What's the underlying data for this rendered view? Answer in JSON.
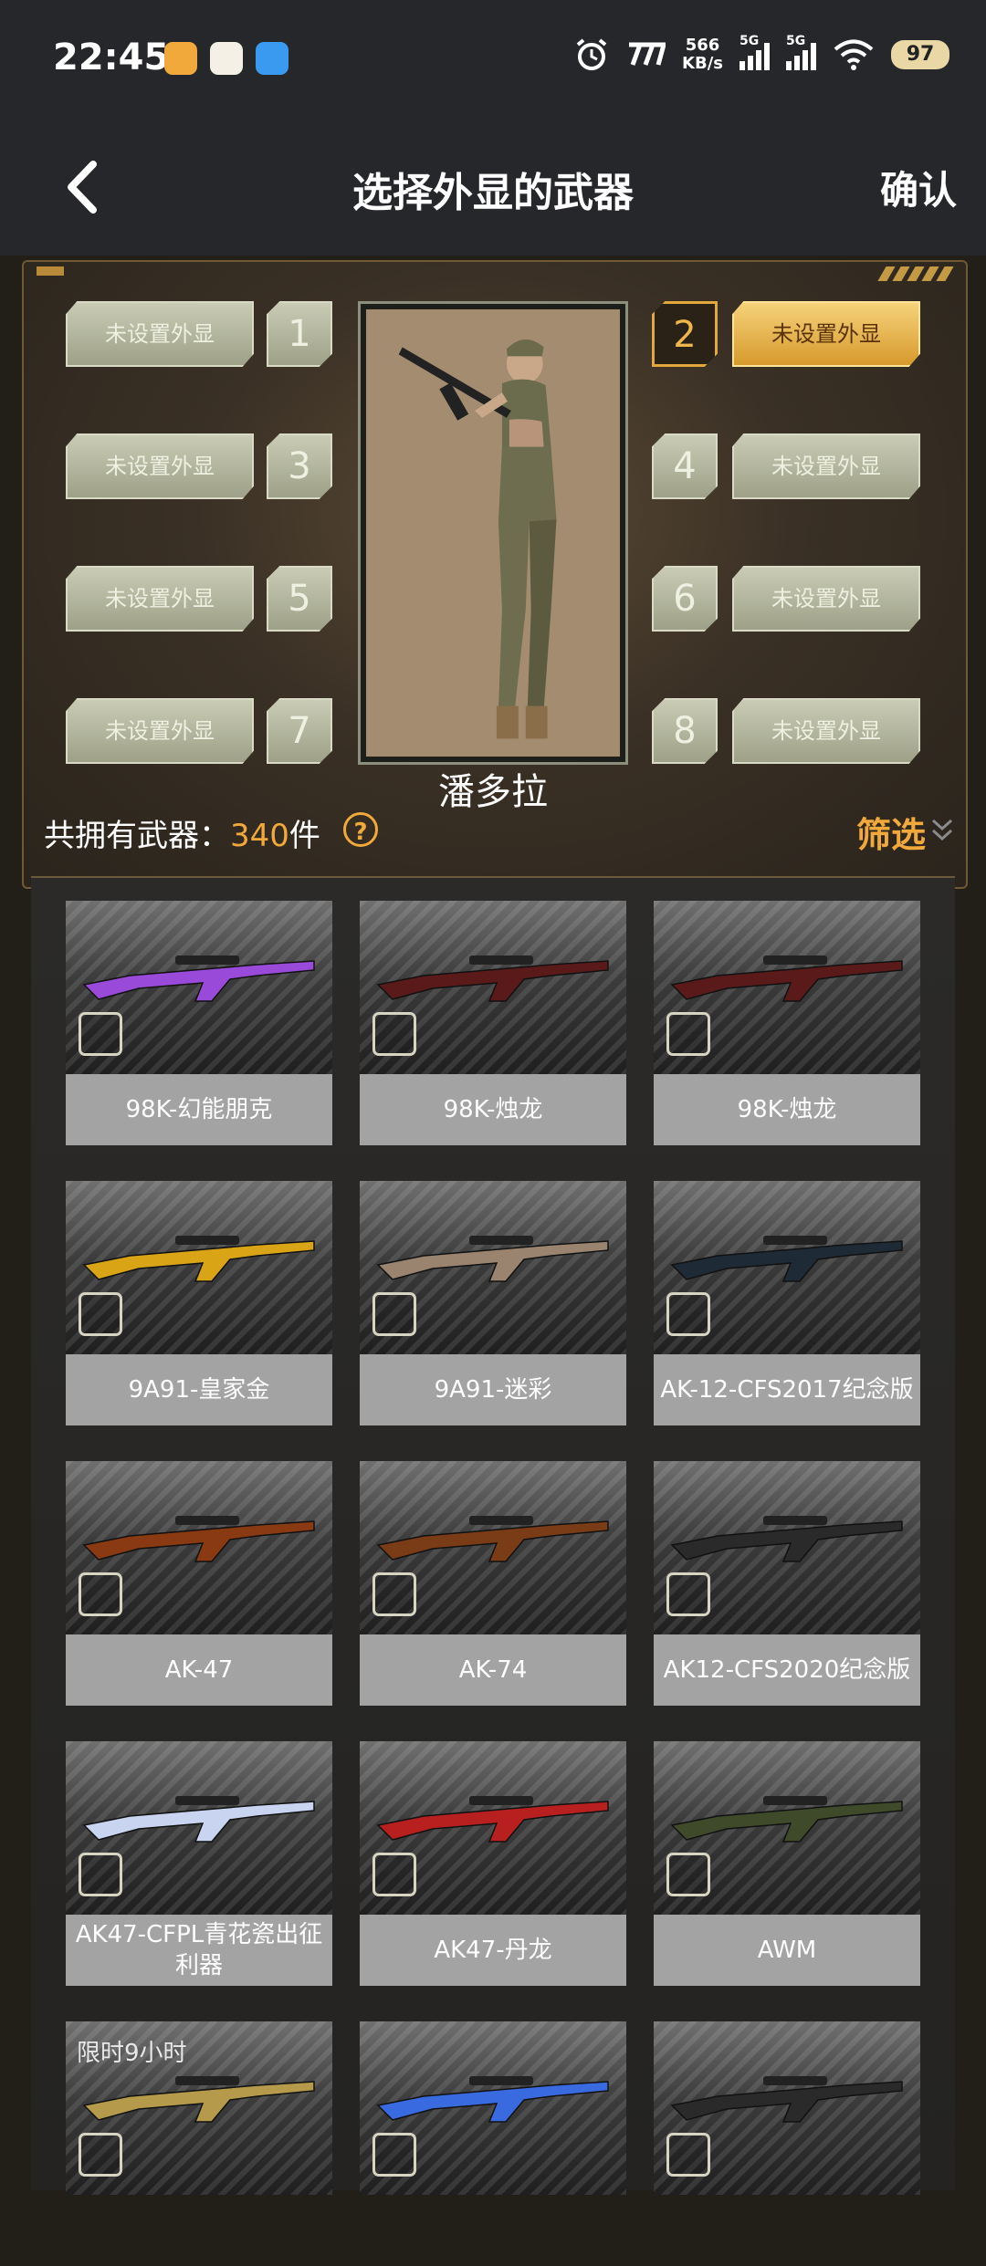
{
  "status": {
    "time": "22:45",
    "net_speed_value": "566",
    "net_speed_unit": "KB/s",
    "sig1_tag": "5G",
    "sig2_tag": "5G",
    "battery": "97"
  },
  "header": {
    "title": "选择外显的武器",
    "confirm": "确认"
  },
  "slots": [
    {
      "label": "未设置外显",
      "num": "1"
    },
    {
      "label": "未设置外显",
      "num": "2",
      "active": true
    },
    {
      "label": "未设置外显",
      "num": "3"
    },
    {
      "label": "未设置外显",
      "num": "4"
    },
    {
      "label": "未设置外显",
      "num": "5"
    },
    {
      "label": "未设置外显",
      "num": "6"
    },
    {
      "label": "未设置外显",
      "num": "7"
    },
    {
      "label": "未设置外显",
      "num": "8"
    }
  ],
  "character": {
    "name": "潘多拉"
  },
  "summary": {
    "prefix": "共拥有武器：",
    "count": "340",
    "suffix": "件",
    "help": "?",
    "filter": "筛选"
  },
  "weapons": [
    {
      "name": "98K-幻能朋克",
      "color": "#9a4ad8"
    },
    {
      "name": "98K-烛龙",
      "color": "#5a1a1a"
    },
    {
      "name": "98K-烛龙",
      "color": "#5a1a1a"
    },
    {
      "name": "9A91-皇家金",
      "color": "#d9a516"
    },
    {
      "name": "9A91-迷彩",
      "color": "#9a8470"
    },
    {
      "name": "AK-12-CFS2017纪念版",
      "color": "#1e2a36"
    },
    {
      "name": "AK-47",
      "color": "#8a3a12"
    },
    {
      "name": "AK-74",
      "color": "#7a3c16"
    },
    {
      "name": "AK12-CFS2020纪念版",
      "color": "#2a2a2a"
    },
    {
      "name": "AK47-CFPL青花瓷出征利器",
      "color": "#c9d4f0"
    },
    {
      "name": "AK47-丹龙",
      "color": "#b82020"
    },
    {
      "name": "AWM",
      "color": "#3e4a2a"
    },
    {
      "name": "",
      "color": "#b49a4a",
      "timer": "限时9小时"
    },
    {
      "name": "",
      "color": "#3a6ae0"
    },
    {
      "name": "",
      "color": "#2a2a2a"
    }
  ]
}
